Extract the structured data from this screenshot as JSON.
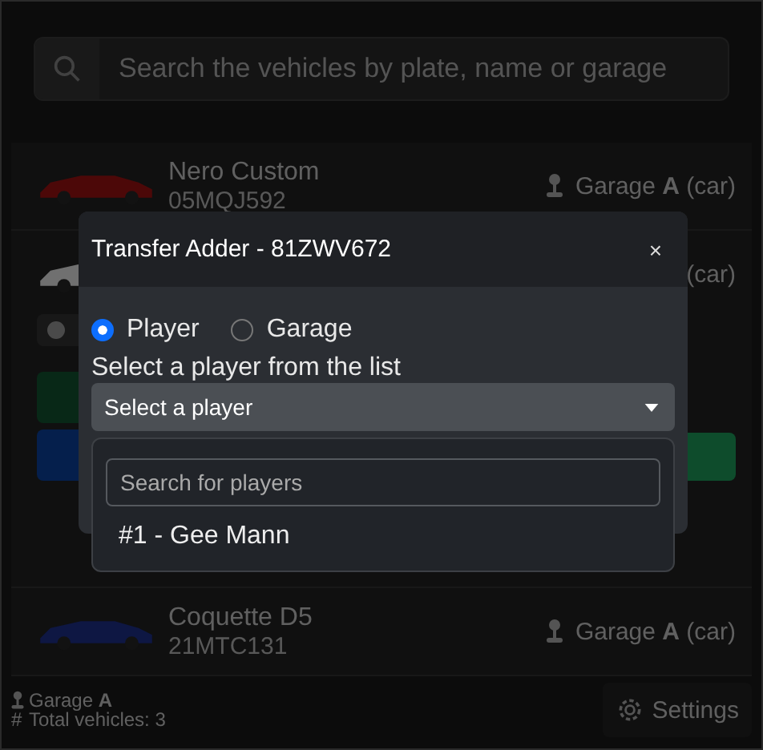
{
  "search": {
    "placeholder": "Search the vehicles by plate, name or garage"
  },
  "vehicles": [
    {
      "name": "Nero Custom",
      "plate": "05MQJ592",
      "location": "Garage **A** (car)",
      "expanded": false
    },
    {
      "location": "(car)",
      "expanded": true
    },
    {
      "name": "Coquette D5",
      "plate": "21MTC131",
      "location": "Garage **A** (car)",
      "expanded": false
    }
  ],
  "footer": {
    "garage": "Garage **A**",
    "count_mark": "#",
    "total": "Total vehicles: 3",
    "settings": "Settings"
  },
  "modal": {
    "title": "Transfer Adder - 81ZWV672",
    "close": "×",
    "targets": [
      {
        "label": "Player",
        "selected": true
      },
      {
        "label": "Garage",
        "selected": false
      }
    ],
    "prompt": "Select a player from the list",
    "select": {
      "placeholder": "Select a player",
      "expanded": true
    },
    "dropdown": {
      "search_placeholder": "Search for players",
      "options": [
        "#1 - Gee Mann"
      ]
    }
  }
}
